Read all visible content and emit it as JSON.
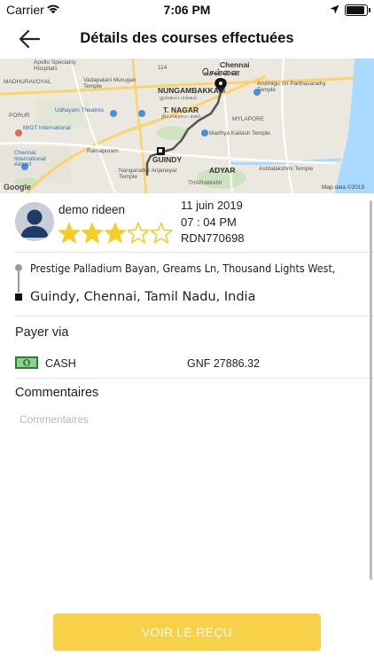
{
  "status_bar": {
    "carrier": "Carrier",
    "time": "7:06 PM"
  },
  "nav": {
    "title": "Détails des courses effectuées",
    "back_icon": "arrow-left-icon"
  },
  "map": {
    "labels": {
      "chennai": "Chennai",
      "chennai_tamil": "சென்னை",
      "nungambakkam": "NUNGAMBAKKAM",
      "nungambakkam_tamil": "நுங்கம்பாக்கம்",
      "t_nagar": "T. NAGAR",
      "t_nagar_tamil": "தியாகராய நகர்",
      "guindy": "GUINDY",
      "adyar": "ADYAR",
      "mylapore": "MYLAPORE",
      "apollo": "Apollo Speciality Hospitals",
      "madhuravoyal": "MADHURAVOYAL",
      "vadapalani": "Vadapalani Murugan Temple",
      "udhayam": "Udhayam Theatres",
      "miot": "MIOT International",
      "porur": "PORUR",
      "ramapuram": "Ramapuram",
      "airport": "Chennai International Airport",
      "anjaneyar": "Nanganallur Anjaneyar Temple",
      "arulmigu": "Arulmigu Sri Parthasarathy Temple",
      "kailash": "Madhya Kailash Temple",
      "ashtalakshmi": "Ashtalakshmi Temple",
      "tharamani": "THARAMANI",
      "road_114": "114",
      "google": "Google",
      "map_data": "Map data ©2019"
    }
  },
  "ride": {
    "rider_name": "demo rideen",
    "rating": 3,
    "rating_max": 5,
    "date": "11 juin 2019",
    "time": "07 : 04 PM",
    "ride_id": "RDN770698"
  },
  "route": {
    "pickup": "Prestige Palladium Bayan, Greams Ln, Thousand Lights West,",
    "dropoff": "Guindy, Chennai, Tamil Nadu, India"
  },
  "payment": {
    "title": "Payer via",
    "method": "CASH",
    "amount": "GNF 27886.32",
    "icon": "cash-icon"
  },
  "comments": {
    "title": "Commentaires",
    "placeholder": "Commentaires",
    "value": ""
  },
  "receipt_button": {
    "label": "VOIR LE REÇU"
  },
  "colors": {
    "accent": "#f7d148",
    "star": "#f5cd27",
    "map_water": "#aadaff",
    "route_line": "#555555"
  }
}
